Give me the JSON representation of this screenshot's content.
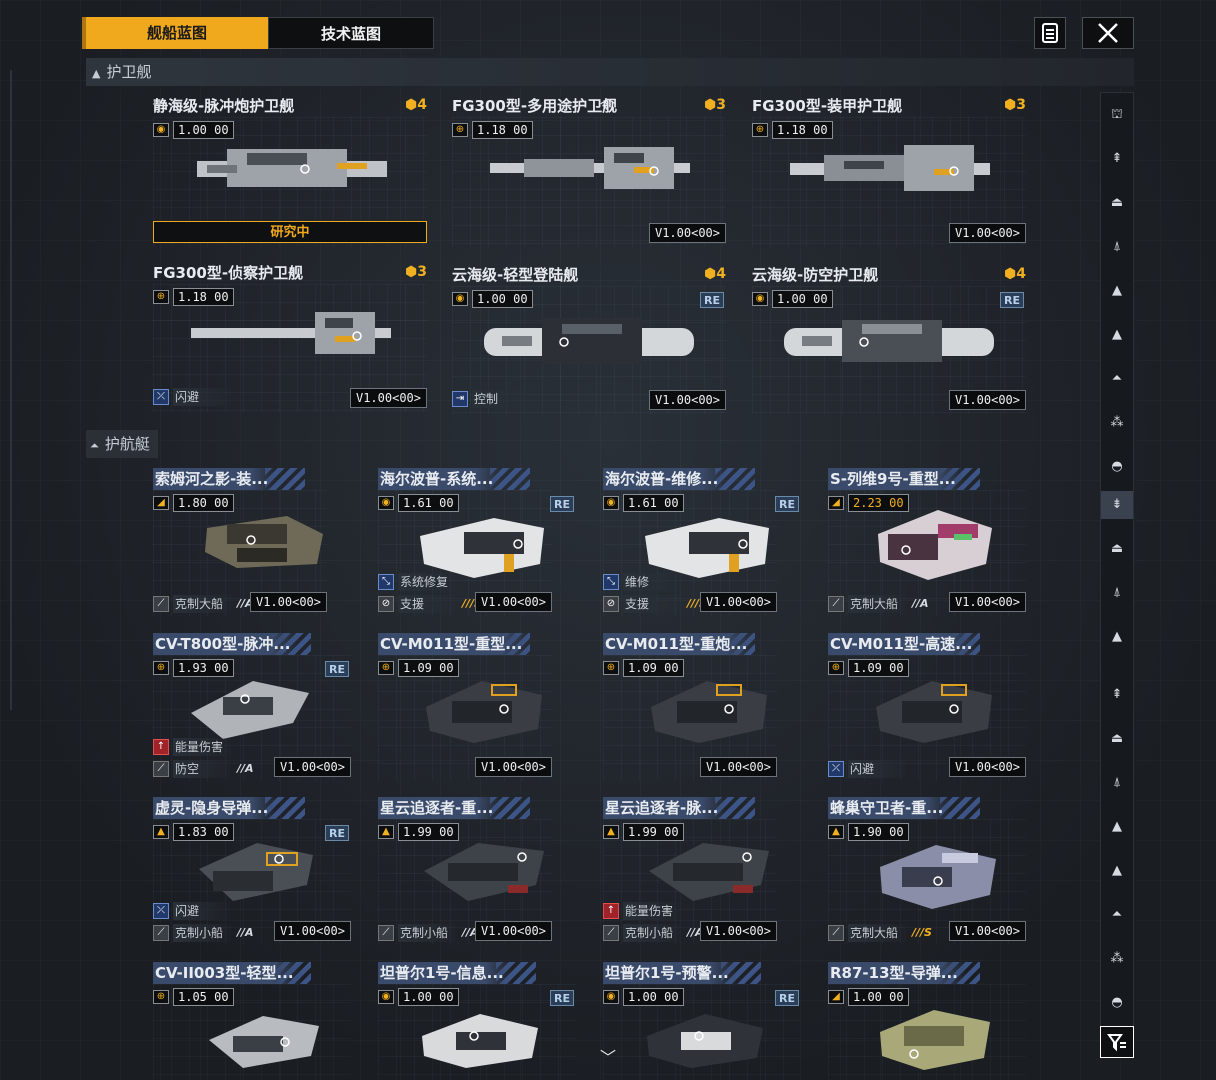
{
  "tabs": {
    "ship": "舰船蓝图",
    "tech": "技术蓝图"
  },
  "sections": {
    "frigate": "护卫舰",
    "escort": "护航艇"
  },
  "frigates": [
    {
      "title": "静海级-脉冲炮护卫舰",
      "tier": "4",
      "version": "1.00",
      "suffix": "00",
      "status": "研究中"
    },
    {
      "title": "FG300型-多用途护卫舰",
      "tier": "3",
      "version": "1.18",
      "suffix": "00",
      "build": "V1.00<00>"
    },
    {
      "title": "FG300型-装甲护卫舰",
      "tier": "3",
      "version": "1.18",
      "suffix": "00",
      "build": "V1.00<00>"
    },
    {
      "title": "FG300型-侦察护卫舰",
      "tier": "3",
      "version": "1.18",
      "suffix": "00",
      "tag": "闪避",
      "build": "V1.00<00>"
    },
    {
      "title": "云海级-轻型登陆舰",
      "tier": "4",
      "version": "1.00",
      "suffix": "00",
      "re": "RE",
      "tag": "控制",
      "build": "V1.00<00>"
    },
    {
      "title": "云海级-防空护卫舰",
      "tier": "4",
      "version": "1.00",
      "suffix": "00",
      "re": "RE",
      "build": "V1.00<00>"
    }
  ],
  "escorts": [
    {
      "title": "索姆河之影-装...",
      "version": "1.80",
      "suffix": "00",
      "tag1": "克制大船",
      "rank1": "//A",
      "build": "V1.00<00>"
    },
    {
      "title": "海尔波普-系统...",
      "version": "1.61",
      "suffix": "00",
      "re": "RE",
      "tag0": "系统修复",
      "tag1": "支援",
      "rank1": "///S",
      "build": "V1.00<00>"
    },
    {
      "title": "海尔波普-维修...",
      "version": "1.61",
      "suffix": "00",
      "re": "RE",
      "tag0": "维修",
      "tag1": "支援",
      "rank1": "///S",
      "build": "V1.00<00>"
    },
    {
      "title": "S-列维9号-重型...",
      "version": "2.23",
      "suffix": "00",
      "tag1": "克制大船",
      "rank1": "//A",
      "build": "V1.00<00>"
    },
    {
      "title": "CV-T800型-脉冲...",
      "version": "1.93",
      "suffix": "00",
      "re": "RE",
      "tag0": "能量伤害",
      "tag1": "防空",
      "rank1": "//A",
      "build": "V1.00<00>"
    },
    {
      "title": "CV-M011型-重型...",
      "version": "1.09",
      "suffix": "00",
      "build": "V1.00<00>"
    },
    {
      "title": "CV-M011型-重炮...",
      "version": "1.09",
      "suffix": "00",
      "build": "V1.00<00>"
    },
    {
      "title": "CV-M011型-高速...",
      "version": "1.09",
      "suffix": "00",
      "tag1": "闪避",
      "build": "V1.00<00>"
    },
    {
      "title": "虚灵-隐身导弹...",
      "version": "1.83",
      "suffix": "00",
      "re": "RE",
      "tag0": "闪避",
      "tag1": "克制小船",
      "rank1": "//A",
      "build": "V1.00<00>"
    },
    {
      "title": "星云追逐者-重...",
      "version": "1.99",
      "suffix": "00",
      "tag1": "克制小船",
      "rank1": "//A",
      "build": "V1.00<00>"
    },
    {
      "title": "星云追逐者-脉...",
      "version": "1.99",
      "suffix": "00",
      "tag0": "能量伤害",
      "tag1": "克制小船",
      "rank1": "//A",
      "build": "V1.00<00>"
    },
    {
      "title": "蜂巢守卫者-重...",
      "version": "1.90",
      "suffix": "00",
      "tag1": "克制大船",
      "rank1": "///S",
      "build": "V1.00<00>"
    },
    {
      "title": "CV-II003型-轻型...",
      "version": "1.05",
      "suffix": "00"
    },
    {
      "title": "坦普尔1号-信息...",
      "version": "1.00",
      "suffix": "00",
      "re": "RE"
    },
    {
      "title": "坦普尔1号-预警...",
      "version": "1.00",
      "suffix": "00",
      "re": "RE"
    },
    {
      "title": "R87-13型-导弹...",
      "version": "1.00",
      "suffix": "00"
    }
  ],
  "icons": [
    "list-icon",
    "close-icon",
    "filter-icon",
    "chevron-up-icon",
    "chevron-down-icon"
  ],
  "colors": {
    "accent": "#f0a81c",
    "background": "#1c2026",
    "re_badge": "#2a3e58"
  }
}
